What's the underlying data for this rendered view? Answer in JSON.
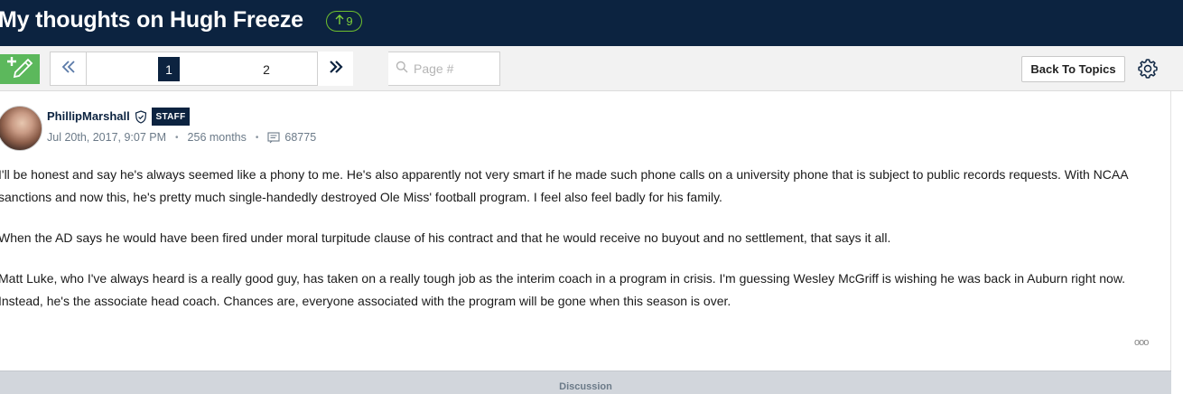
{
  "topic": {
    "title": "My thoughts on Hugh Freeze",
    "vote_count": "9"
  },
  "toolbar": {
    "pages": [
      "1",
      "2"
    ],
    "current_page": "1",
    "page_input_placeholder": "Page #",
    "back_label": "Back To Topics"
  },
  "post": {
    "author": "PhillipMarshall",
    "badge": "STAFF",
    "date": "Jul 20th, 2017, 9:07 PM",
    "tenure": "256 months",
    "post_count": "68775",
    "paragraphs": [
      "I'll be honest and say he's always seemed like a phony to me. He's also apparently not very smart if he made such phone calls on a university phone that is subject to public records requests. With NCAA sanctions and now this, he's pretty much single-handedly destroyed Ole Miss' football program. I feel also feel badly for his family.",
      "When the AD says he would have been fired under moral turpitude clause of his contract and that he would receive no buyout and no settlement, that says it all.",
      "Matt Luke, who I've always heard is a really good guy, has taken on a really tough job as the interim coach in a program in crisis. I'm guessing Wesley McGriff is wishing he was back in Auburn right now. Instead, he's the associate head coach. Chances are, everyone associated with the program will be gone when this season is over."
    ],
    "more_label": "ooo"
  },
  "footer": {
    "discussion_label": "Discussion"
  },
  "colors": {
    "header_bg": "#0c2340",
    "vote_green": "#7ed03a",
    "new_post_green": "#5cb85c"
  },
  "icons": [
    "new-post-icon",
    "up-arrow-icon",
    "double-chevron-left-icon",
    "double-chevron-right-icon",
    "search-icon",
    "gear-icon",
    "verified-shield-icon",
    "posts-icon"
  ]
}
